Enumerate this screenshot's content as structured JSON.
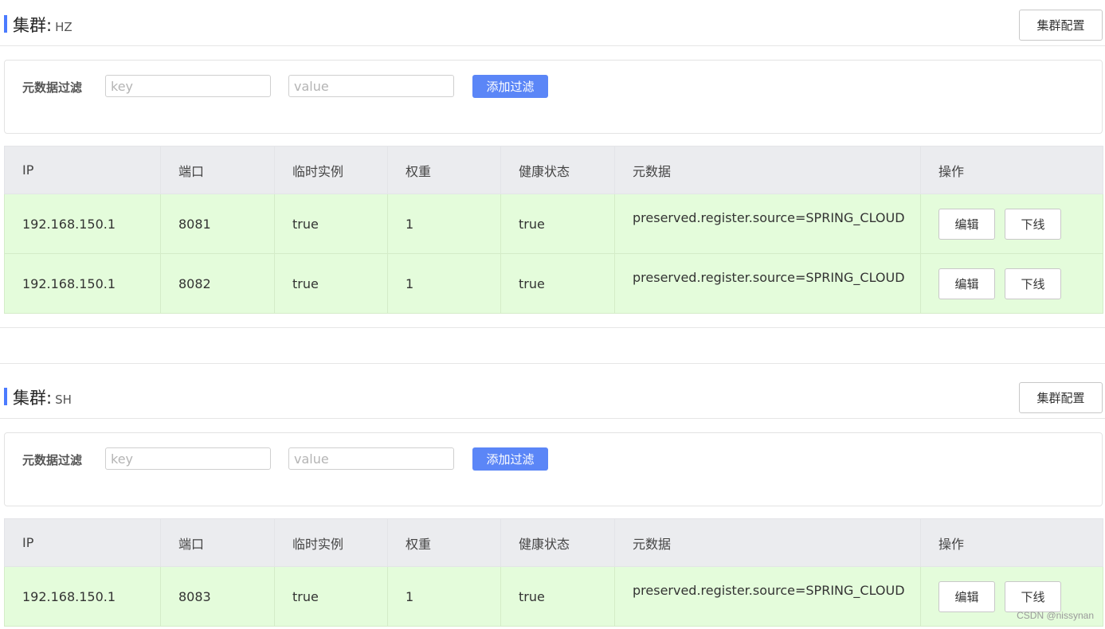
{
  "clusters": [
    {
      "title_prefix": "集群:",
      "name": "HZ",
      "config_button": "集群配置",
      "filter": {
        "label": "元数据过滤",
        "key_placeholder": "key",
        "value_placeholder": "value",
        "add_button": "添加过滤"
      },
      "columns": [
        "IP",
        "端口",
        "临时实例",
        "权重",
        "健康状态",
        "元数据",
        "操作"
      ],
      "rows": [
        {
          "ip": "192.168.150.1",
          "port": "8081",
          "ephemeral": "true",
          "weight": "1",
          "healthy": "true",
          "metadata": "preserved.register.source=SPRING_CLOUD",
          "edit": "编辑",
          "offline": "下线"
        },
        {
          "ip": "192.168.150.1",
          "port": "8082",
          "ephemeral": "true",
          "weight": "1",
          "healthy": "true",
          "metadata": "preserved.register.source=SPRING_CLOUD",
          "edit": "编辑",
          "offline": "下线"
        }
      ]
    },
    {
      "title_prefix": "集群:",
      "name": "SH",
      "config_button": "集群配置",
      "filter": {
        "label": "元数据过滤",
        "key_placeholder": "key",
        "value_placeholder": "value",
        "add_button": "添加过滤"
      },
      "columns": [
        "IP",
        "端口",
        "临时实例",
        "权重",
        "健康状态",
        "元数据",
        "操作"
      ],
      "rows": [
        {
          "ip": "192.168.150.1",
          "port": "8083",
          "ephemeral": "true",
          "weight": "1",
          "healthy": "true",
          "metadata": "preserved.register.source=SPRING_CLOUD",
          "edit": "编辑",
          "offline": "下线"
        }
      ]
    }
  ],
  "watermark": "CSDN @nissynan",
  "colors": {
    "accent": "#4b7bff",
    "add_button": "#5b86f7",
    "row_background": "#e4fcdb",
    "header_background": "#ebecef"
  }
}
